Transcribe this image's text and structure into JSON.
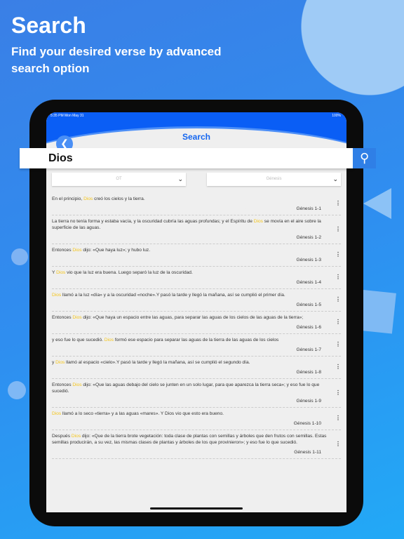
{
  "promo": {
    "title": "Search",
    "subtitle": "Find your desired verse by advanced search option"
  },
  "status": {
    "time": "5:35 PM  Mon May 31",
    "battery": "100%"
  },
  "header": {
    "title": "Search",
    "back_icon": "chevron-left-icon"
  },
  "search": {
    "value": "Dios",
    "icon": "search-icon"
  },
  "filters": {
    "testament": "OT",
    "book": "Génesis"
  },
  "colors": {
    "accent": "#0a5ef5",
    "highlight": "#f5c518"
  },
  "verses": [
    {
      "before": "En el principio, ",
      "hl": "Dios",
      "after": " creó los cielos y la tierra.",
      "ref": "Génesis 1-1"
    },
    {
      "before": "La tierra no tenía forma y estaba vacía, y la oscuridad cubría las aguas profundas; y el Espíritu de ",
      "hl": "Dios",
      "after": " se movía en el aire sobre la superficie de las aguas.",
      "ref": "Génesis 1-2"
    },
    {
      "before": "Entonces ",
      "hl": "Dios",
      "after": " dijo: «Que haya luz»; y hubo luz.",
      "ref": "Génesis 1-3"
    },
    {
      "before": "Y ",
      "hl": "Dios",
      "after": " vio que la luz era buena. Luego separó la luz de la oscuridad.",
      "ref": "Génesis 1-4"
    },
    {
      "before": "",
      "hl": "Dios",
      "after": " llamó a la luz «día» y a la oscuridad «noche».Y pasó la tarde y llegó la mañana, así se cumplió el primer día.",
      "ref": "Génesis 1-5"
    },
    {
      "before": "Entonces ",
      "hl": "Dios",
      "after": " dijo: «Que haya un espacio entre las aguas, para separar las aguas de los cielos de las aguas de la tierra»;",
      "ref": "Génesis 1-6"
    },
    {
      "before": "y eso fue lo que sucedió. ",
      "hl": "Dios",
      "after": " formó ese espacio para separar las aguas de la tierra de las aguas de los cielos",
      "ref": "Génesis 1-7"
    },
    {
      "before": "y ",
      "hl": "Dios",
      "after": " llamó al espacio «cielo».Y pasó la tarde y llegó la mañana, así se cumplió el segundo día.",
      "ref": "Génesis 1-8"
    },
    {
      "before": "Entonces ",
      "hl": "Dios",
      "after": " dijo: «Que las aguas debajo del cielo se junten en un solo lugar, para que aparezca la tierra seca»; y eso fue lo que sucedió.",
      "ref": "Génesis 1-9"
    },
    {
      "before": "",
      "hl": "Dios",
      "after": " llamó a lo seco «tierra» y a las aguas «mares». Y Dios vio que esto era bueno.",
      "ref": "Génesis 1-10"
    },
    {
      "before": "Después ",
      "hl": "Dios",
      "after": " dijo: «Que de la tierra brote vegetación: toda clase de plantas con semillas y árboles que den frutos con semillas. Estas semillas producirán, a su vez, las mismas clases de plantas y árboles de los que provinieron»; y eso fue lo que sucedió.",
      "ref": "Génesis 1-11"
    }
  ]
}
